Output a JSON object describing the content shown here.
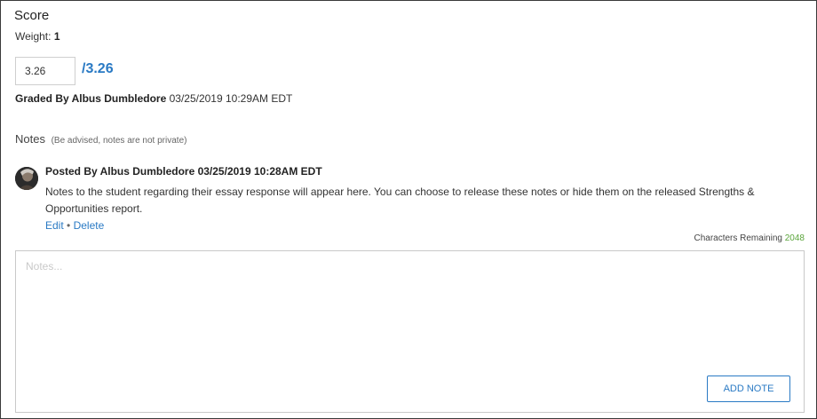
{
  "score": {
    "title": "Score",
    "weight_label": "Weight:",
    "weight_value": "1",
    "input_value": "3.26",
    "total": "/3.26",
    "graded_by_label": "Graded By Albus Dumbledore",
    "graded_timestamp": "03/25/2019 10:29AM EDT"
  },
  "notes": {
    "title": "Notes",
    "privacy_note": "(Be advised, notes are not private)",
    "posted_by": "Posted By Albus Dumbledore 03/25/2019 10:28AM EDT",
    "body": "Notes to the student regarding their essay response will appear here. You can choose to release these notes or hide them on the released Strengths & Opportunities report.",
    "edit_label": "Edit",
    "separator": "•",
    "delete_label": "Delete",
    "chars_label": "Characters Remaining",
    "chars_count": "2048",
    "placeholder": "Notes...",
    "add_button_label": "ADD NOTE"
  },
  "colors": {
    "accent": "#2a7ac4",
    "chars_count": "#5aa53b",
    "frame_border": "#3a3a3a"
  }
}
